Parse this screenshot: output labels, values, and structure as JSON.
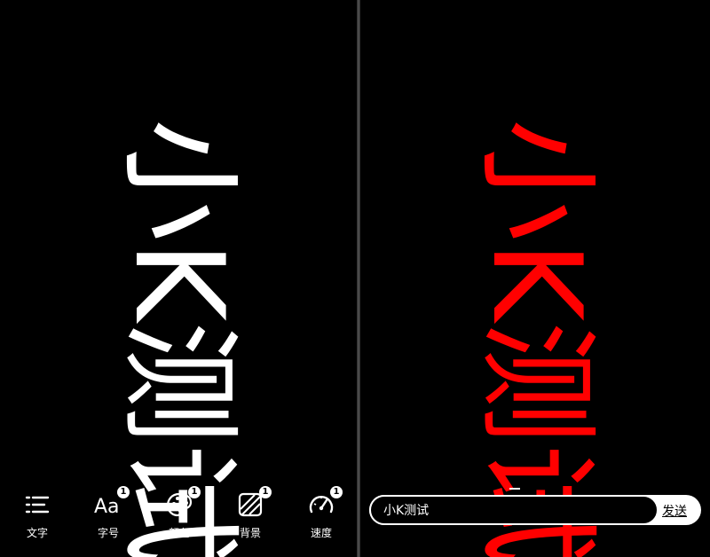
{
  "marquee": {
    "text": "小K测试",
    "left_color": "#ffffff",
    "right_color": "#ff0000"
  },
  "toolbar": {
    "items": [
      {
        "label": "文字",
        "icon": "text-lines-icon",
        "badge": ""
      },
      {
        "label": "字号",
        "icon": "font-size-icon",
        "badge": "1"
      },
      {
        "label": "颜色",
        "icon": "palette-icon",
        "badge": "1"
      },
      {
        "label": "背景",
        "icon": "background-icon",
        "badge": "1"
      },
      {
        "label": "速度",
        "icon": "speedometer-icon",
        "badge": "1"
      }
    ]
  },
  "input": {
    "value": "小K测试",
    "send_label": "发送"
  },
  "colors": {
    "background": "#000000",
    "accent": "#ff0000"
  }
}
